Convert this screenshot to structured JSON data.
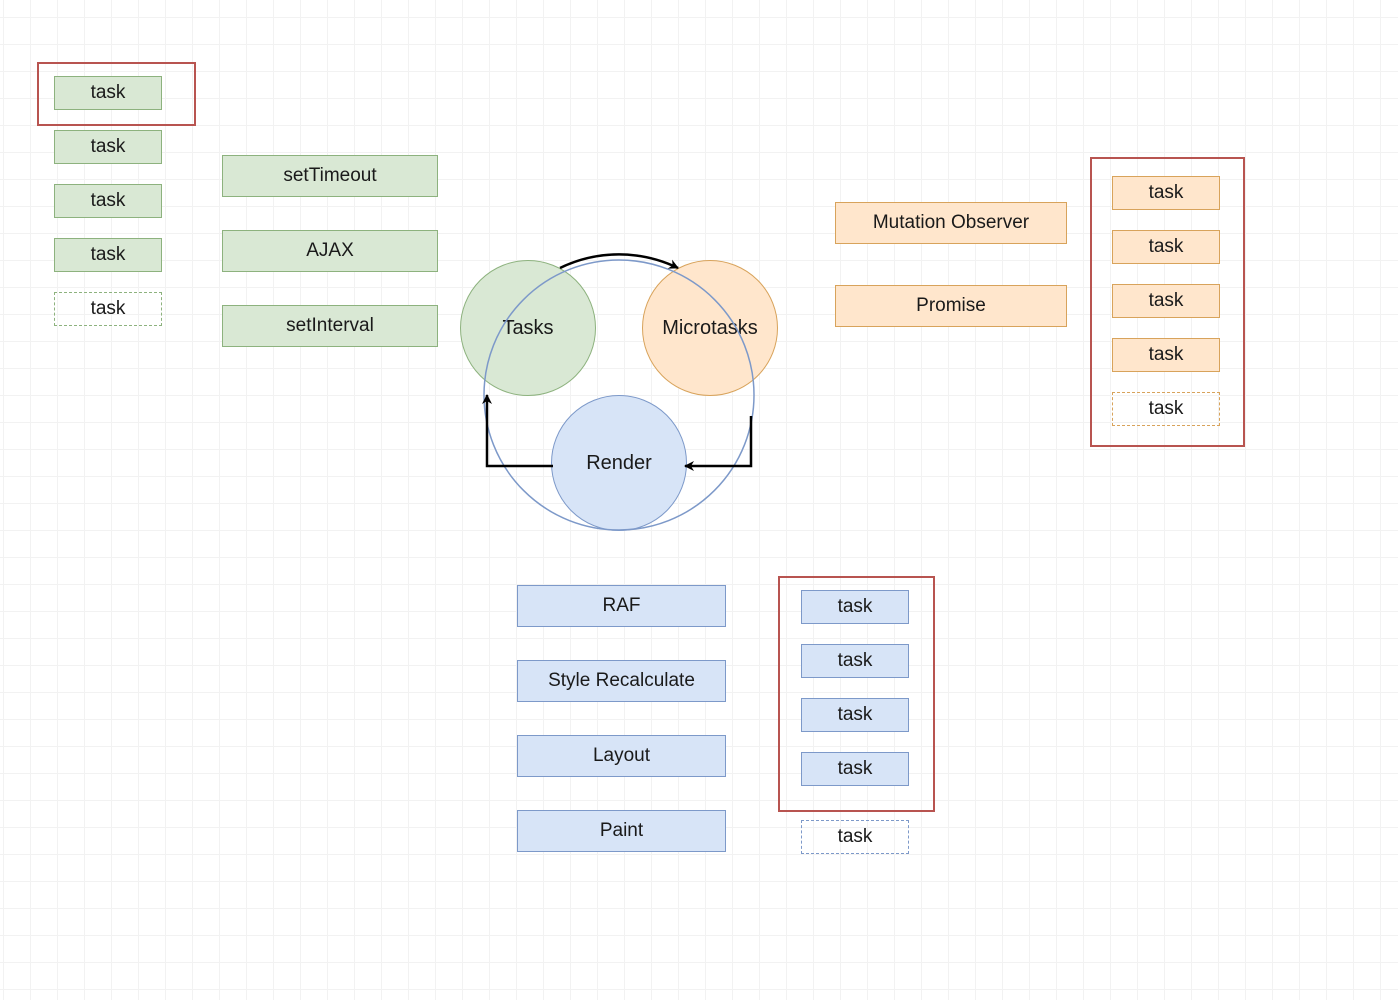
{
  "colors": {
    "green_fill": "#d9e8d4",
    "green_border": "#8db27e",
    "orange_fill": "#ffe6cc",
    "orange_border": "#d8a35b",
    "blue_fill": "#d7e4f7",
    "blue_border": "#7d99c9",
    "red_border": "#b85450"
  },
  "circles": {
    "tasks": "Tasks",
    "microtasks": "Microtasks",
    "render": "Render"
  },
  "task_sources": {
    "items": [
      "setTimeout",
      "AJAX",
      "setInterval"
    ]
  },
  "microtask_sources": {
    "items": [
      "Mutation Observer",
      "Promise"
    ]
  },
  "render_steps": {
    "items": [
      "RAF",
      "Style Recalculate",
      "Layout",
      "Paint"
    ]
  },
  "task_queue": {
    "items": [
      "task",
      "task",
      "task",
      "task"
    ],
    "placeholder": "task"
  },
  "microtask_queue": {
    "items": [
      "task",
      "task",
      "task",
      "task"
    ],
    "placeholder": "task"
  },
  "render_queue": {
    "items": [
      "task",
      "task",
      "task",
      "task"
    ],
    "placeholder": "task"
  }
}
